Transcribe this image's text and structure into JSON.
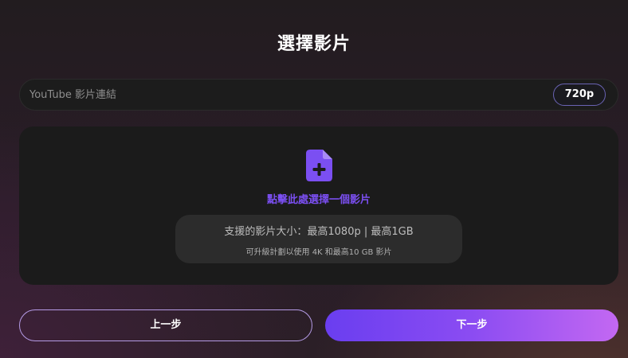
{
  "page": {
    "title": "選擇影片"
  },
  "url_bar": {
    "placeholder": "YouTube 影片連結",
    "quality": "720p"
  },
  "upload": {
    "icon": "file-add-icon",
    "label": "點擊此處選擇一個影片",
    "info_main": "支援的影片大小：最高1080p | 最高1GB",
    "info_sub": "可升級計劃以使用 4K 和最高10 GB 影片"
  },
  "buttons": {
    "prev": "上一步",
    "next": "下一步"
  },
  "colors": {
    "accent": "#7b4ff2",
    "next_gradient_start": "#6a3ef0",
    "next_gradient_end": "#c368f2",
    "panel": "#1b1b1b",
    "info_box": "#2c2c2c"
  }
}
